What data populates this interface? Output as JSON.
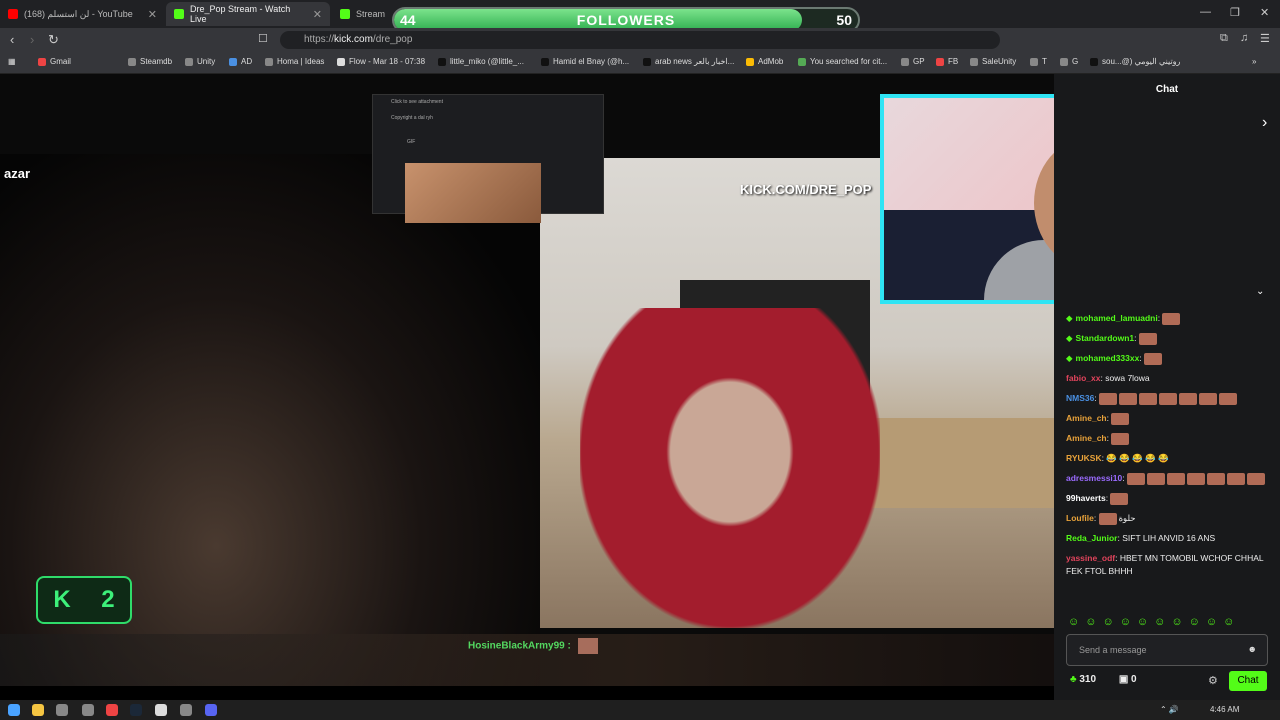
{
  "tabs": [
    {
      "label": "(168) لن استسلم - YouTube",
      "color": "#ff0000"
    },
    {
      "label": "Dre_Pop Stream - Watch Live",
      "color": "#53fc18"
    },
    {
      "label": "Stream",
      "color": "#53fc18"
    }
  ],
  "followers": {
    "current": "44",
    "goal": "50",
    "label": "FOLLOWERS",
    "progress": 0.88
  },
  "url": {
    "prefix": "https://",
    "host": "kick.com",
    "path": "/dre_pop"
  },
  "bookmarks": [
    "Gmail",
    "Steamdb",
    "Unity",
    "AD",
    "Homa | Ideas",
    "Flow - Mar 18 - 07:38",
    "little_miko (@little_...",
    "Hamid el Bnay (@h...",
    "arab news اخبار بالعر...",
    "AdMob",
    "You searched for cit...",
    "GP",
    "FB",
    "SaleUnity",
    "T",
    "G",
    "sou...@) روتيني اليومي"
  ],
  "video": {
    "azar_logo": "azar",
    "watermark": "KICK.COM/DRE_POP",
    "k_badge": "2",
    "overlay_user": "HosineBlackArmy99",
    "popup_lines": [
      "Click to see attachment",
      "Copyright a dal ryh",
      "GIF"
    ]
  },
  "chat": {
    "title": "Chat",
    "messages": [
      {
        "user": "mohamed_lamuadni",
        "color": "#53fc18",
        "badge": true,
        "text": "",
        "emotes": 1
      },
      {
        "user": "Standardown1",
        "color": "#53fc18",
        "badge": true,
        "text": "",
        "emotes": 1
      },
      {
        "user": "mohamed333xx",
        "color": "#53fc18",
        "badge": true,
        "text": "",
        "emotes": 1
      },
      {
        "user": "fabio_xx",
        "color": "#e2445c",
        "badge": false,
        "text": "sowa 7lowa",
        "emotes": 0
      },
      {
        "user": "NMS36",
        "color": "#4a90e2",
        "badge": false,
        "text": "",
        "emotes": 7
      },
      {
        "user": "Amine_ch",
        "color": "#e8a23a",
        "badge": false,
        "text": "",
        "emotes": 1
      },
      {
        "user": "Amine_ch",
        "color": "#e8a23a",
        "badge": false,
        "text": "",
        "emotes": 1
      },
      {
        "user": "RYUKSK",
        "color": "#e8a23a",
        "badge": false,
        "text": "😂 😂 😂 😂 😂",
        "emotes": 0
      },
      {
        "user": "adresmessi10",
        "color": "#9b6bff",
        "badge": false,
        "text": "",
        "emotes": 7
      },
      {
        "user": "99haverts",
        "color": "#ffffff",
        "badge": false,
        "text": "",
        "emotes": 1
      },
      {
        "user": "Loufile",
        "color": "#e8a23a",
        "badge": false,
        "text": "حلوة",
        "emotes": 1
      },
      {
        "user": "Reda_Junior",
        "color": "#53fc18",
        "badge": false,
        "text": "SIFT LIH ANVID 16 ANS",
        "emotes": 0
      },
      {
        "user": "yassine_odf",
        "color": "#e2445c",
        "badge": false,
        "text": "HBET MN TOMOBIL WCHOF CHHAL FEK FTOL BHHH",
        "emotes": 0
      }
    ],
    "input_placeholder": "Send a message",
    "points": "310",
    "count": "0",
    "send_label": "Chat"
  },
  "taskbar": {
    "time": "4:46 AM"
  }
}
